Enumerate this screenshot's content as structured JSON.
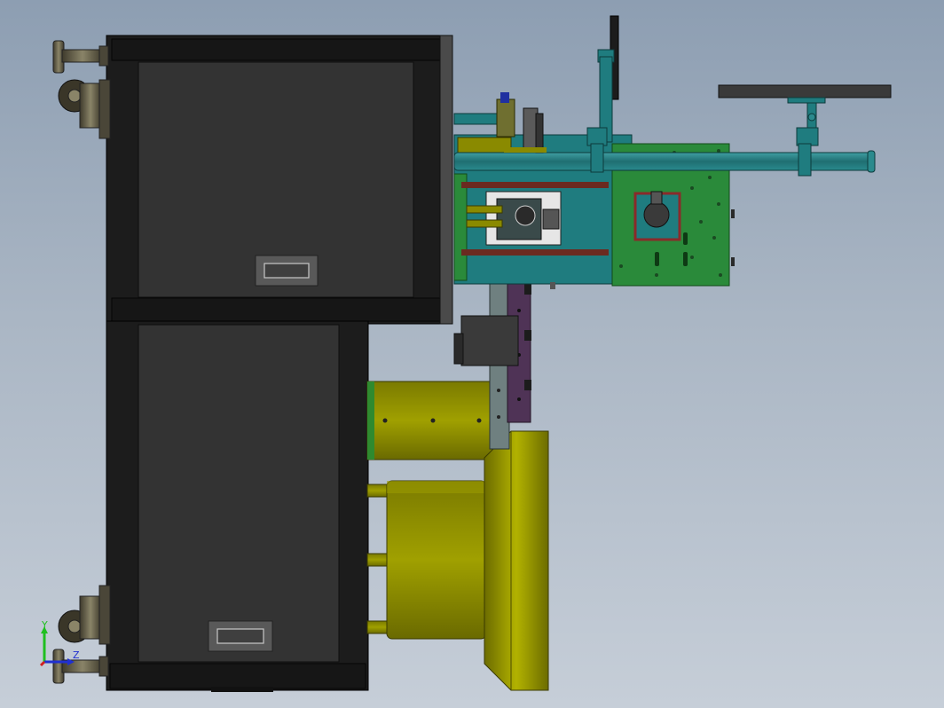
{
  "viewport": {
    "background_top": "#8d9eb2",
    "background_bottom": "#c6ced8"
  },
  "colors": {
    "cabinet_frame": "#1c1c1c",
    "cabinet_panel": "#333333",
    "handle": "#595959",
    "teal_frame": "#1f7c7f",
    "teal_dark": "#14585a",
    "pcb_green": "#2a8a3a",
    "olive": "#8a8a00",
    "olive_light": "#a8a800",
    "olive_dark": "#5c5c00",
    "caster_metal": "#5e5a48",
    "rust_bar": "#6b2a20",
    "purple_rail": "#4f3356",
    "arm_gray": "#3a3a3a",
    "triad_x": "#d02020",
    "triad_y": "#1fbf1f",
    "triad_z": "#2030d0"
  },
  "triad": {
    "x_label": "",
    "y_label": "Y",
    "z_label": "Z"
  }
}
